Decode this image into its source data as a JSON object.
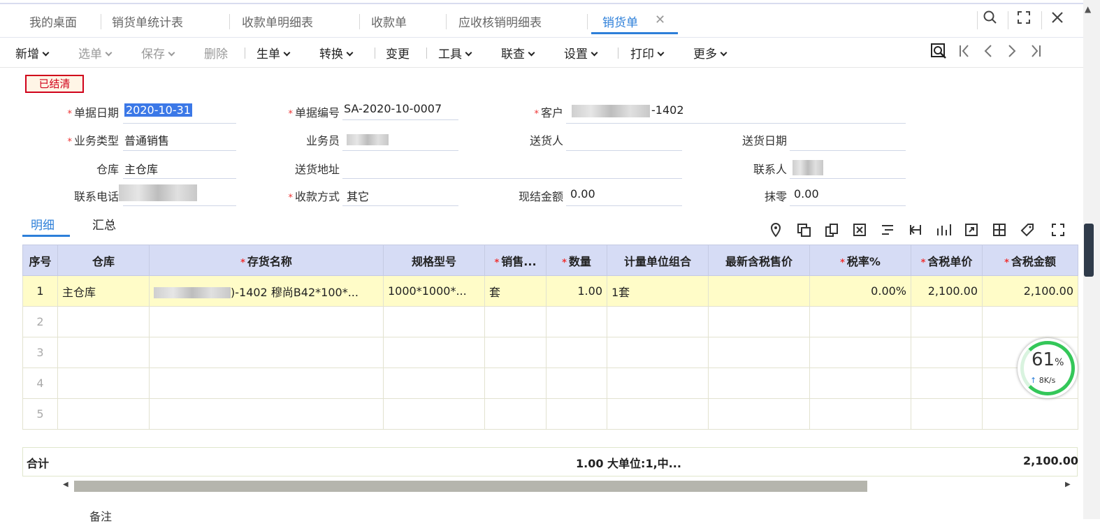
{
  "tabs": [
    {
      "label": "我的桌面"
    },
    {
      "label": "销货单统计表"
    },
    {
      "label": "收款单明细表"
    },
    {
      "label": "收款单"
    },
    {
      "label": "应收核销明细表"
    },
    {
      "label": "销货单",
      "active": true
    }
  ],
  "toolbar": {
    "items": [
      "新增",
      "选单",
      "保存",
      "删除",
      "生单",
      "转换",
      "变更",
      "工具",
      "联查",
      "设置",
      "打印",
      "更多"
    ]
  },
  "status_badge": "已结清",
  "form": {
    "doc_date": {
      "label": "单据日期",
      "value": "2020-10-31"
    },
    "doc_no": {
      "label": "单据编号",
      "value": "SA-2020-10-0007"
    },
    "customer": {
      "label": "客户",
      "value": "-1402"
    },
    "biz_type": {
      "label": "业务类型",
      "value": "普通销售"
    },
    "salesman": {
      "label": "业务员",
      "value": ""
    },
    "deliverer": {
      "label": "送货人",
      "value": ""
    },
    "delivery_date": {
      "label": "送货日期",
      "value": ""
    },
    "warehouse": {
      "label": "仓库",
      "value": "主仓库"
    },
    "delivery_addr": {
      "label": "送货地址",
      "value": ""
    },
    "contact": {
      "label": "联系人",
      "value": ""
    },
    "phone": {
      "label": "联系电话",
      "value": ""
    },
    "payment": {
      "label": "收款方式",
      "value": "其它"
    },
    "cash_amount": {
      "label": "现结金额",
      "value": "0.00"
    },
    "rounding": {
      "label": "抹零",
      "value": "0.00"
    }
  },
  "detail_tabs": [
    "明细",
    "汇总"
  ],
  "grid": {
    "headers": [
      "序号",
      "仓库",
      "存货名称",
      "规格型号",
      "销售...",
      "数量",
      "计量单位组合",
      "最新含税售价",
      "税率%",
      "含税单价",
      "含税金额"
    ],
    "rows": [
      [
        "1",
        "主仓库",
        ")-1402 穆尚B42*100*...",
        "1000*1000*...",
        "套",
        "1.00",
        "1套",
        "",
        "0.00%",
        "2,100.00",
        "2,100.00"
      ],
      [
        "2",
        "",
        "",
        "",
        "",
        "",
        "",
        "",
        "",
        "",
        ""
      ],
      [
        "3",
        "",
        "",
        "",
        "",
        "",
        "",
        "",
        "",
        "",
        ""
      ],
      [
        "4",
        "",
        "",
        "",
        "",
        "",
        "",
        "",
        "",
        "",
        ""
      ],
      [
        "5",
        "",
        "",
        "",
        "",
        "",
        "",
        "",
        "",
        "",
        ""
      ]
    ]
  },
  "totals": {
    "label": "合计",
    "qty": "1.00 大单位:1,中...",
    "amount": "2,100.00"
  },
  "remark_label": "备注",
  "gauge": {
    "percent": "61",
    "unit": "%",
    "speed": "8K/s"
  },
  "colors": {
    "accent": "#2d7fd9",
    "header_bg": "#d6dcf5",
    "row_highlight": "#fffcc8",
    "stamp": "#d0021b"
  }
}
